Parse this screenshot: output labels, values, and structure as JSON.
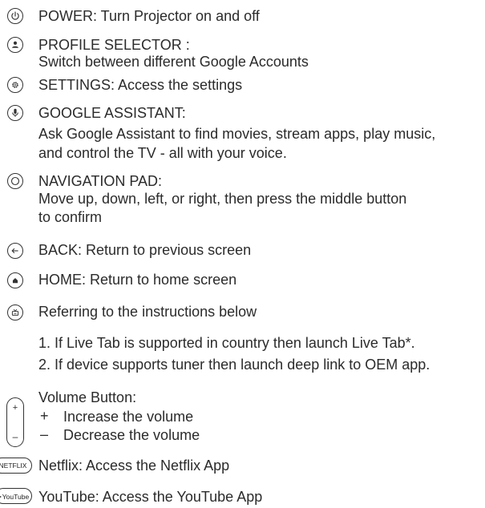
{
  "items": [
    {
      "icon": "power-icon",
      "title": "POWER: Turn Projector on and off"
    },
    {
      "icon": "profile-icon",
      "title": "PROFILE SELECTOR :",
      "desc": [
        "Switch between different Google Accounts"
      ]
    },
    {
      "icon": "settings-icon",
      "title": "SETTINGS: Access the settings"
    },
    {
      "icon": "microphone-icon",
      "title": "GOOGLE ASSISTANT:",
      "desc": [
        "Ask Google Assistant to find movies, stream apps, play music,",
        "and control the TV - all with your voice."
      ]
    },
    {
      "icon": "navigation-pad-icon",
      "title": "NAVIGATION PAD:",
      "desc": [
        "Move up, down, left, or right, then press the middle button",
        "to confirm"
      ]
    },
    {
      "icon": "back-arrow-icon",
      "title": "BACK: Return to previous screen"
    },
    {
      "icon": "home-icon",
      "title": "HOME: Return to home screen"
    },
    {
      "icon": "tv-icon",
      "title": "Referring to the instructions below",
      "list": [
        "1. If Live Tab is supported in country then launch Live Tab*.",
        "2. If device supports tuner then launch deep link to OEM app."
      ]
    }
  ],
  "volume": {
    "icon": "volume-rocker-icon",
    "title": "Volume Button:",
    "plus_symbol": "+",
    "minus_symbol": "–",
    "increase": "Increase the volume",
    "decrease": "Decrease the volume"
  },
  "netflix": {
    "badge": "NETFLIX",
    "text": "Netflix: Access the Netflix App"
  },
  "youtube": {
    "badge": "YouTube",
    "text": "YouTube: Access the YouTube App"
  }
}
